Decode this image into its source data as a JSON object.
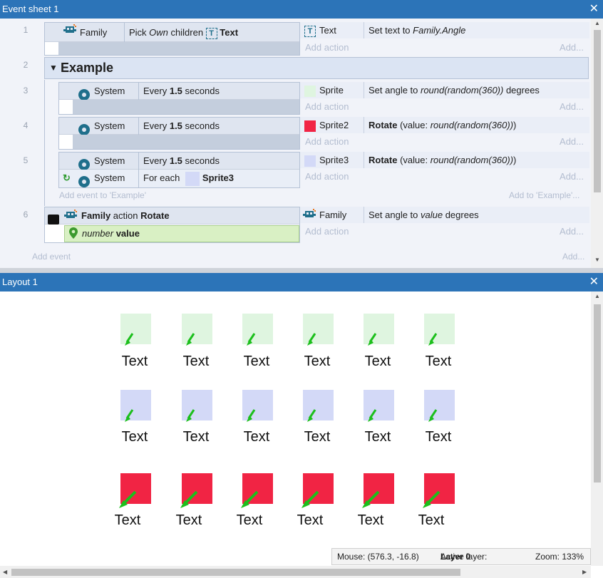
{
  "event_sheet": {
    "title": "Event sheet 1",
    "ev1": {
      "num": "1",
      "cond_object": "Family",
      "cond_text_pre": "Pick ",
      "cond_text_own": "Own",
      "cond_text_mid": " children ",
      "cond_text_obj": "Text",
      "act_object": "Text",
      "act_pre": "Set text to ",
      "act_it": "Family.Angle"
    },
    "group": {
      "num": "2",
      "title": "Example"
    },
    "ev3": {
      "num": "3",
      "cond_object": "System",
      "cond_pre": "Every ",
      "cond_val": "1.5",
      "cond_post": " seconds",
      "act_object": "Sprite",
      "act_pre": "Set angle to ",
      "act_it": "round(random(360))",
      "act_post": " degrees"
    },
    "ev4": {
      "num": "4",
      "cond_object": "System",
      "cond_pre": "Every ",
      "cond_val": "1.5",
      "cond_post": " seconds",
      "act_object": "Sprite2",
      "act_bold": "Rotate",
      "act_mid": " (value: ",
      "act_it": "round(random(360))",
      "act_post": ")"
    },
    "ev5": {
      "num": "5",
      "cond_object": "System",
      "cond_pre": "Every ",
      "cond_val": "1.5",
      "cond_post": " seconds",
      "cond2_object": "System",
      "cond2_pre": "For each ",
      "cond2_obj": "Sprite3",
      "act_object": "Sprite3",
      "act_bold": "Rotate",
      "act_mid": " (value: ",
      "act_it": "round(random(360))",
      "act_post": ")"
    },
    "add_event_to_group": "Add event to 'Example'",
    "add_to_group": "Add to 'Example'...",
    "ev6": {
      "num": "6",
      "func_obj": "Family",
      "func_mid": " action ",
      "func_name": "Rotate",
      "param_type": "number",
      "param_name": "value",
      "act_object": "Family",
      "act_pre": "Set angle to ",
      "act_it": "value",
      "act_post": " degrees"
    },
    "add_action": "Add action",
    "add_more": "Add...",
    "add_event": "Add event"
  },
  "layout": {
    "title": "Layout 1",
    "text_label": "Text",
    "rows": [
      {
        "color": "#dff5e0",
        "names": [
          "Sprite",
          "Sprite",
          "Sprite",
          "Sprite",
          "Sprite",
          "Sprite"
        ]
      },
      {
        "color": "#d3d9f7",
        "names": [
          "Sprite3",
          "Sprite3",
          "Sprite3",
          "Sprite3",
          "Sprite3",
          "Sprite3"
        ]
      },
      {
        "color": "#f12444",
        "names": [
          "Sprite2",
          "Sprite2",
          "Sprite2",
          "Sprite2",
          "Sprite2",
          "Sprite2"
        ]
      }
    ],
    "status": {
      "mouse": "Mouse: (576.3, -16.8)",
      "layer_label": "Active layer: ",
      "layer_value": "Layer 0",
      "zoom": "Zoom: 133%"
    }
  },
  "colors": {
    "titlebar": "#2c74b8",
    "sprite_green": "#dff5e0",
    "sprite_blue": "#d3d9f7",
    "sprite_red": "#f12444",
    "arrow_green": "#1cbf1c",
    "param_bg": "#d9f0c4"
  },
  "icons": [
    "family-icon",
    "text-object-icon",
    "gear-icon",
    "loop-icon",
    "function-icon",
    "location-pin-icon",
    "close-icon",
    "collapse-triangle-icon"
  ]
}
